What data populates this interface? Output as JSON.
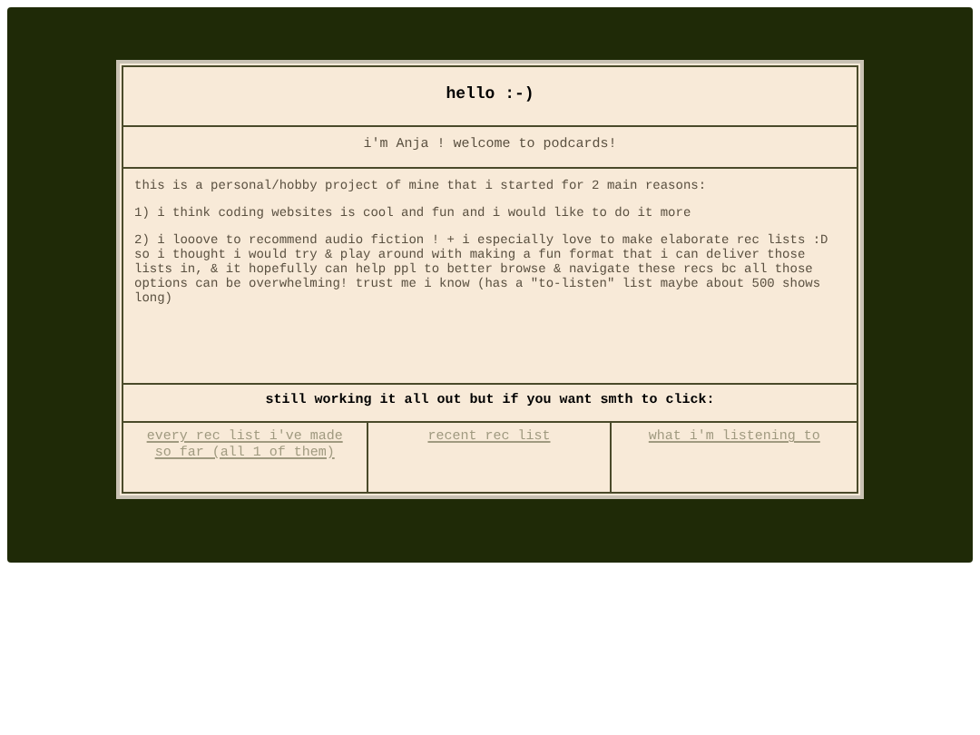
{
  "title": "hello :-)",
  "subtitle": "i'm Anja ! welcome to podcards!",
  "paragraphs": [
    "this is a personal/hobby project of mine that i started for 2 main reasons:",
    "1) i think coding websites is cool and fun and i would like to do it more",
    "2) i looove to recommend audio fiction ! + i especially love to make elaborate rec lists :D so i thought i would try & play around with making a fun format that i can deliver those lists in, & it hopefully can help ppl to better browse & navigate these recs bc all those options can be overwhelming! trust me i know (has a \"to-listen\" list maybe about 500 shows long)"
  ],
  "links_heading": "still working it all out but if you want smth to click:",
  "links": [
    {
      "label": "every rec list i've made so far (all 1 of them)"
    },
    {
      "label": "recent rec list"
    },
    {
      "label": "what i'm listening to"
    }
  ]
}
